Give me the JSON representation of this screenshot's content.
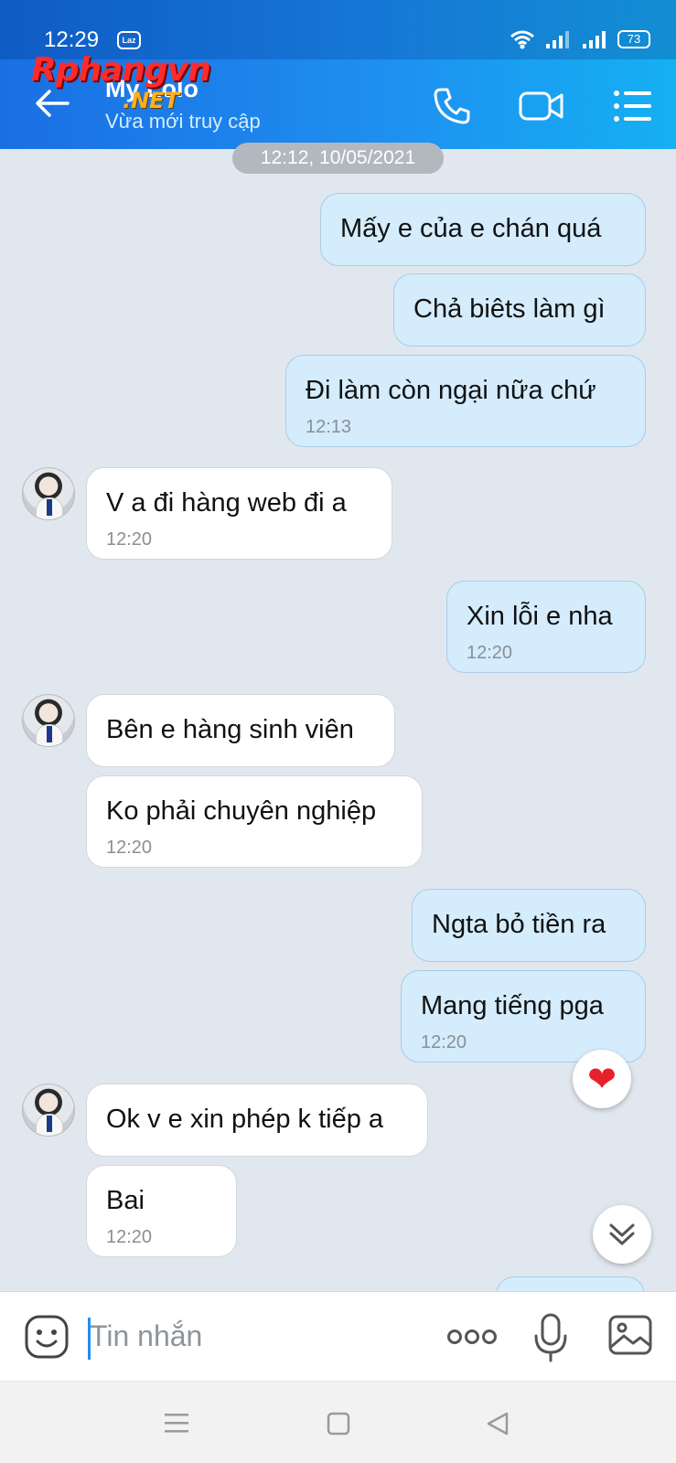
{
  "status_bar": {
    "time": "12:29",
    "app_badge": "Laz",
    "battery": "73"
  },
  "header": {
    "title": "My Lolo",
    "subtitle": "Vừa mới truy cập",
    "watermark_main": "Rphangvn",
    "watermark_sub": ".NET",
    "icons": [
      "back-arrow-icon",
      "phone-icon",
      "video-call-icon",
      "menu-list-icon"
    ]
  },
  "chat": {
    "date_separator": "12:12, 10/05/2021",
    "messages": [
      {
        "dir": "out",
        "text": "Mấy e của e chán quá",
        "time": ""
      },
      {
        "dir": "out",
        "text": "Chả biêts làm gì",
        "time": ""
      },
      {
        "dir": "out",
        "text": "Đi làm còn ngại nữa chứ",
        "time": "12:13"
      },
      {
        "dir": "in",
        "text": "V a đi hàng web đi a",
        "time": "12:20"
      },
      {
        "dir": "out",
        "text": "Xin lỗi e nha",
        "time": "12:20"
      },
      {
        "dir": "in",
        "text": "Bên e hàng sinh viên",
        "time": ""
      },
      {
        "dir": "in",
        "text": "Ko phải chuyên nghiệp",
        "time": "12:20"
      },
      {
        "dir": "out",
        "text": "Ngta bỏ tiền ra",
        "time": ""
      },
      {
        "dir": "out",
        "text": "Mang tiếng pga",
        "time": "12:20"
      },
      {
        "dir": "in",
        "text": "Ok v e xin phép k tiếp a",
        "time": ""
      },
      {
        "dir": "in",
        "text": "Bai",
        "time": "12:20"
      }
    ],
    "reaction": "❤"
  },
  "input": {
    "placeholder": "Tin nhắn"
  },
  "colors": {
    "header_start": "#1a6fe3",
    "header_end": "#15b0f2",
    "outgoing_bubble": "#d4ecfc",
    "incoming_bubble": "#ffffff",
    "chat_background": "#e1e7ef",
    "accent": "#1f8ef1"
  }
}
